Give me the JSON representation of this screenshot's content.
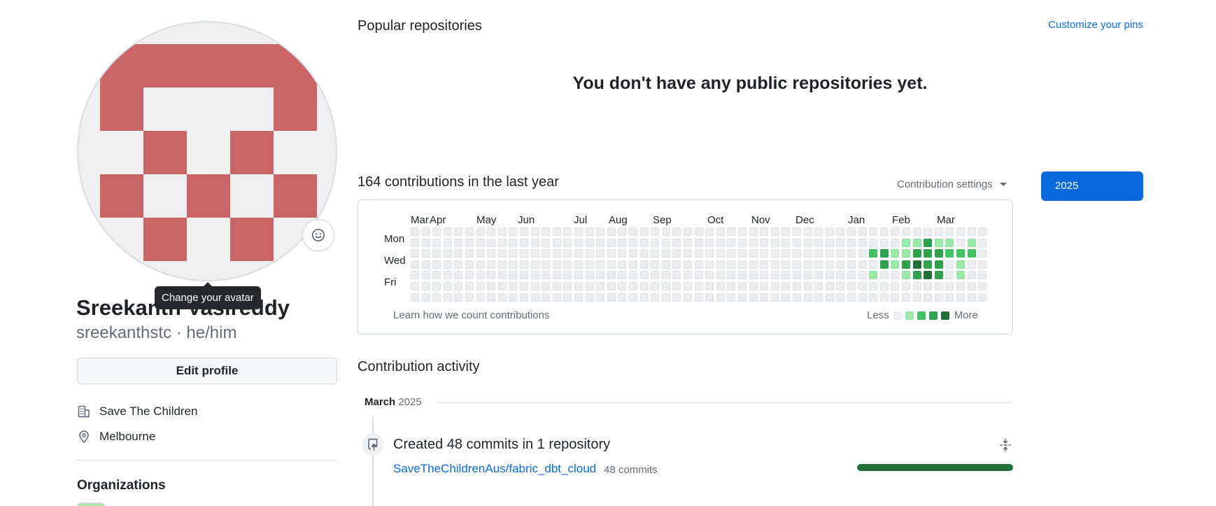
{
  "profile": {
    "full_name": "Sreekanth Vasireddy",
    "username_line": "sreekanthstc · he/him",
    "avatar_tooltip": "Change your avatar",
    "avatar_color": "#c96467",
    "edit_profile_label": "Edit profile",
    "organization": "Save The Children",
    "location": "Melbourne",
    "organizations_title": "Organizations"
  },
  "repos": {
    "title": "Popular repositories",
    "customize_label": "Customize your pins",
    "empty_message": "You don't have any public repositories yet."
  },
  "contributions": {
    "title": "164 contributions in the last year",
    "settings_label": "Contribution settings",
    "year_button": "2025",
    "months": [
      "Mar",
      "Apr",
      "May",
      "Jun",
      "Jul",
      "Aug",
      "Sep",
      "Oct",
      "Nov",
      "Dec",
      "Jan",
      "Feb",
      "Mar"
    ],
    "day_labels": [
      "Mon",
      "Wed",
      "Fri"
    ],
    "learn_link": "Learn how we count contributions",
    "legend_less": "Less",
    "legend_more": "More",
    "level_colors": [
      "#ebedf0",
      "#9be9a8",
      "#40c463",
      "#30a14e",
      "#216e39"
    ],
    "weeks": 53,
    "active_cells": [
      {
        "week": 42,
        "day": 2,
        "level": 2
      },
      {
        "week": 42,
        "day": 4,
        "level": 1
      },
      {
        "week": 43,
        "day": 2,
        "level": 3
      },
      {
        "week": 43,
        "day": 3,
        "level": 3
      },
      {
        "week": 44,
        "day": 2,
        "level": 1
      },
      {
        "week": 44,
        "day": 3,
        "level": 1
      },
      {
        "week": 45,
        "day": 1,
        "level": 1
      },
      {
        "week": 45,
        "day": 2,
        "level": 1
      },
      {
        "week": 45,
        "day": 3,
        "level": 3
      },
      {
        "week": 45,
        "day": 4,
        "level": 1
      },
      {
        "week": 46,
        "day": 1,
        "level": 1
      },
      {
        "week": 46,
        "day": 2,
        "level": 3
      },
      {
        "week": 46,
        "day": 3,
        "level": 4
      },
      {
        "week": 46,
        "day": 4,
        "level": 3
      },
      {
        "week": 47,
        "day": 1,
        "level": 3
      },
      {
        "week": 47,
        "day": 2,
        "level": 3
      },
      {
        "week": 47,
        "day": 3,
        "level": 3
      },
      {
        "week": 47,
        "day": 4,
        "level": 4
      },
      {
        "week": 48,
        "day": 1,
        "level": 1
      },
      {
        "week": 48,
        "day": 2,
        "level": 3
      },
      {
        "week": 48,
        "day": 3,
        "level": 3
      },
      {
        "week": 48,
        "day": 4,
        "level": 3
      },
      {
        "week": 49,
        "day": 1,
        "level": 1
      },
      {
        "week": 49,
        "day": 2,
        "level": 2
      },
      {
        "week": 50,
        "day": 2,
        "level": 2
      },
      {
        "week": 50,
        "day": 3,
        "level": 1
      },
      {
        "week": 50,
        "day": 4,
        "level": 1
      },
      {
        "week": 51,
        "day": 1,
        "level": 1
      },
      {
        "week": 51,
        "day": 2,
        "level": 2
      }
    ]
  },
  "activity": {
    "title": "Contribution activity",
    "month": "March",
    "year": "2025",
    "summary": "Created 48 commits in 1 repository",
    "repo_name": "SaveTheChildrenAus/fabric_dbt_cloud",
    "repo_commits": "48 commits",
    "repo_share": 1.0
  }
}
